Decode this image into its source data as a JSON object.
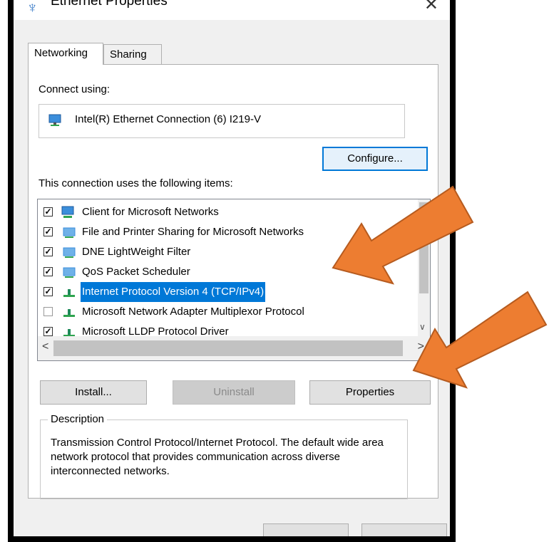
{
  "window": {
    "title": "Ethernet Properties",
    "close_glyph": "✕"
  },
  "tabs": [
    {
      "label": "Networking",
      "active": true
    },
    {
      "label": "Sharing",
      "active": false
    }
  ],
  "connect_using_label": "Connect using:",
  "adapter_name": "Intel(R) Ethernet Connection (6) I219-V",
  "configure_label": "Configure...",
  "items_label": "This connection uses the following items:",
  "items": [
    {
      "label": "Client for Microsoft Networks",
      "checked": true,
      "icon": "network-client-icon"
    },
    {
      "label": "File and Printer Sharing for Microsoft Networks",
      "checked": true,
      "icon": "network-service-icon"
    },
    {
      "label": "DNE LightWeight Filter",
      "checked": true,
      "icon": "network-service-icon"
    },
    {
      "label": "QoS Packet Scheduler",
      "checked": true,
      "icon": "network-service-icon"
    },
    {
      "label": "Internet Protocol Version 4 (TCP/IPv4)",
      "checked": true,
      "icon": "protocol-icon",
      "selected": true
    },
    {
      "label": "Microsoft Network Adapter Multiplexor Protocol",
      "checked": false,
      "icon": "protocol-icon"
    },
    {
      "label": "Microsoft LLDP Protocol Driver",
      "checked": true,
      "icon": "protocol-icon"
    }
  ],
  "buttons": {
    "install": "Install...",
    "uninstall": "Uninstall",
    "properties": "Properties"
  },
  "description": {
    "legend": "Description",
    "text": "Transmission Control Protocol/Internet Protocol. The default wide area network protocol that provides communication across diverse interconnected networks."
  },
  "colors": {
    "selection": "#0078d7",
    "arrow": "#ed7d31"
  }
}
